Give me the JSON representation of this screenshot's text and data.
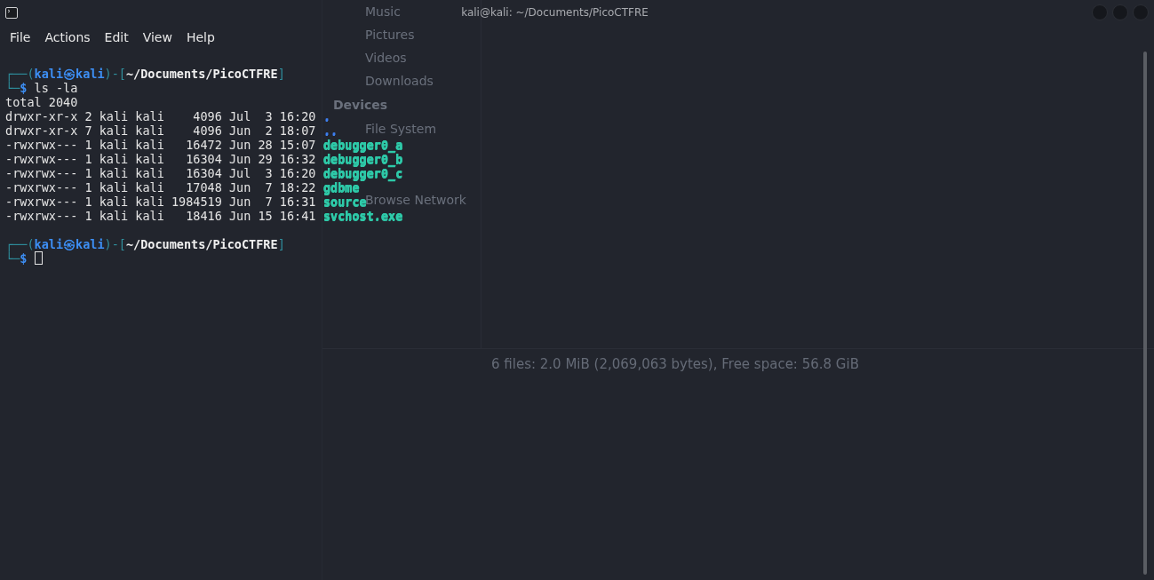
{
  "background_window": {
    "sections": [
      {
        "items": [
          {
            "label": "Music"
          },
          {
            "label": "Pictures"
          },
          {
            "label": "Videos"
          },
          {
            "label": "Downloads"
          }
        ]
      },
      {
        "heading": "Devices",
        "items": [
          {
            "label": "File System"
          }
        ]
      },
      {
        "items": [
          {
            "label": "Browse Network"
          }
        ]
      }
    ],
    "status": "6 files: 2.0 MiB (2,069,063 bytes), Free space: 56.8 GiB"
  },
  "terminal": {
    "title": "kali@kali: ~/Documents/PicoCTFRE",
    "menu": [
      "File",
      "Actions",
      "Edit",
      "View",
      "Help"
    ],
    "lines": [
      {
        "kind": "blank"
      },
      {
        "kind": "prompt",
        "open": "┌──(",
        "user": "kali",
        "at": "㉿",
        "host": "kali",
        "sep": ")-[",
        "path": "~/Documents/PicoCTFRE",
        "close": "]",
        "corner": "└─",
        "sigil": "$",
        "command": "ls -la"
      },
      {
        "kind": "output",
        "text": "total 2040"
      },
      {
        "kind": "entry",
        "meta": "drwxr-xr-x 2 kali kali    4096 Jul  3 16:20",
        "name": ".",
        "color": "#3d7ff0"
      },
      {
        "kind": "entry",
        "meta": "drwxr-xr-x 7 kali kali    4096 Jun  2 18:07",
        "name": "..",
        "color": "#3d7ff0"
      },
      {
        "kind": "entry",
        "meta": "-rwxrwx--- 1 kali kali   16472 Jun 28 15:07",
        "name": "debugger0_a",
        "color": "#2ec9a8"
      },
      {
        "kind": "entry",
        "meta": "-rwxrwx--- 1 kali kali   16304 Jun 29 16:32",
        "name": "debugger0_b",
        "color": "#2ec9a8"
      },
      {
        "kind": "entry",
        "meta": "-rwxrwx--- 1 kali kali   16304 Jul  3 16:20",
        "name": "debugger0_c",
        "color": "#2ec9a8"
      },
      {
        "kind": "entry",
        "meta": "-rwxrwx--- 1 kali kali   17048 Jun  7 18:22",
        "name": "gdbme",
        "color": "#2ec9a8"
      },
      {
        "kind": "entry",
        "meta": "-rwxrwx--- 1 kali kali 1984519 Jun  7 16:31",
        "name": "source",
        "color": "#2ec9a8"
      },
      {
        "kind": "entry",
        "meta": "-rwxrwx--- 1 kali kali   18416 Jun 15 16:41",
        "name": "svchost.exe",
        "color": "#2ec9a8"
      },
      {
        "kind": "blank"
      },
      {
        "kind": "prompt",
        "open": "┌──(",
        "user": "kali",
        "at": "㉿",
        "host": "kali",
        "sep": ")-[",
        "path": "~/Documents/PicoCTFRE",
        "close": "]",
        "corner": "└─",
        "sigil": "$",
        "cursor": true
      }
    ]
  }
}
